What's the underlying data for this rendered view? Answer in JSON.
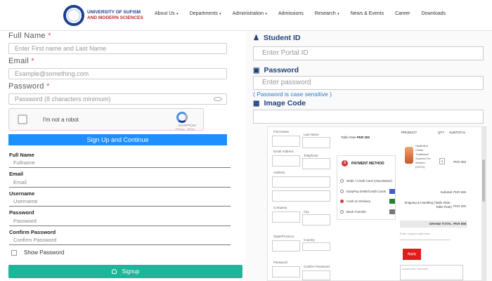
{
  "header": {
    "logo_line1": "UNIVERSITY OF SUFISM",
    "logo_line2": "AND MODERN SCIENCES",
    "nav": [
      {
        "label": "About Us",
        "dropdown": true
      },
      {
        "label": "Departments",
        "dropdown": true
      },
      {
        "label": "Administration",
        "dropdown": true
      },
      {
        "label": "Admissions",
        "dropdown": false
      },
      {
        "label": "Research",
        "dropdown": true
      },
      {
        "label": "News & Events",
        "dropdown": false
      },
      {
        "label": "Career",
        "dropdown": false
      },
      {
        "label": "Downloads",
        "dropdown": false
      }
    ]
  },
  "signup": {
    "full_name_label": "Full Name",
    "full_name_placeholder": "Enter First name and Last Name",
    "email_label": "Email",
    "email_placeholder": "Example@something.com",
    "password_label": "Password",
    "password_placeholder": "Password (8 characters minimum)",
    "required_mark": "*",
    "captcha_label": "I'm not a robot",
    "captcha_brand": "reCAPTCHA",
    "captcha_links": "Privacy - Terms",
    "continue_button": "Sign Up and Continue"
  },
  "form2": {
    "fields": [
      {
        "label": "Full Name",
        "placeholder": "Fullname"
      },
      {
        "label": "Email",
        "placeholder": "Email"
      },
      {
        "label": "Username",
        "placeholder": "Username"
      },
      {
        "label": "Password",
        "placeholder": "Password"
      },
      {
        "label": "Confirm Password",
        "placeholder": "Confirm Password"
      }
    ],
    "show_password": "Show Password",
    "signup_button": "Signup"
  },
  "login": {
    "student_id_label": "Student ID",
    "student_id_placeholder": "Enter Portal ID",
    "password_label": "Password",
    "password_placeholder": "Enter password",
    "case_note": "( Password is case sensitive )",
    "image_code_label": "Image Code"
  },
  "checkout": {
    "first_name": "First Name",
    "last_name": "Last Name",
    "email_address": "Email Address",
    "telephone": "Telephone",
    "address": "Address",
    "company": "Company",
    "city": "City",
    "state": "State/Province",
    "country": "Country",
    "country_value": "Pakistan",
    "password": "Password",
    "confirm_password": "Confirm Password",
    "table_rate": "Table Rate",
    "table_rate_value": "PKR 200",
    "payment_method": "PAYMENT METHOD",
    "payment_step": "3",
    "payment_options": [
      "Debit / Credit Card (Visa,Master)",
      "EasyPay Debit/Credit Cards",
      "Cash on Delivery",
      "Bank Transfer"
    ],
    "col_product": "PRODUCT",
    "col_qty": "QTY",
    "col_subtotal": "SUBTOTAL",
    "product_name": "Healthline Childe Traditional Scarves For Women (XXXX)",
    "qty": "1",
    "line_price": "PKR 659",
    "subtotal_label": "Subtotal",
    "subtotal_value": "PKR 659",
    "shipping_label": "Shipping & Handling (Table Rate - Table Rate)",
    "shipping_value": "PKR 200",
    "grand_total_label": "GRAND TOTAL",
    "grand_total_value": "PKR 859",
    "coupon_placeholder": "Enter coupon code here",
    "apply_button": "Apply",
    "comment_placeholder": "Leave your comment"
  }
}
